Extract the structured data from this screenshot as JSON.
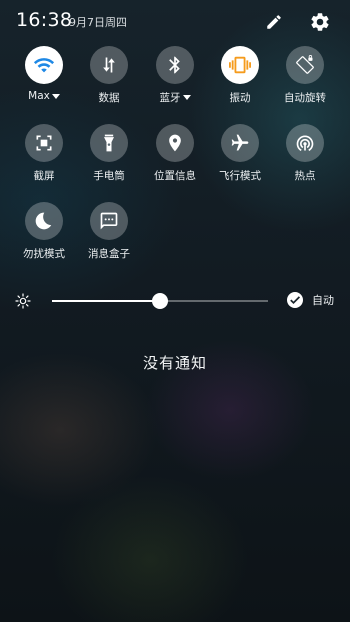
{
  "status_bar": {
    "time": "16:38",
    "date": "9月7日周四",
    "edit_icon": "pencil-icon",
    "settings_icon": "gear-icon"
  },
  "tiles": [
    {
      "label": "Max",
      "icon": "wifi-icon",
      "active": true,
      "dropdown": true
    },
    {
      "label": "数据",
      "icon": "mobile-data-icon",
      "active": false
    },
    {
      "label": "蓝牙",
      "icon": "bluetooth-icon",
      "active": false,
      "dropdown": true
    },
    {
      "label": "振动",
      "icon": "vibrate-icon",
      "active": true
    },
    {
      "label": "自动旋转",
      "icon": "auto-rotate-icon",
      "active": false
    },
    {
      "label": "截屏",
      "icon": "screenshot-icon",
      "active": false
    },
    {
      "label": "手电筒",
      "icon": "flashlight-icon",
      "active": false
    },
    {
      "label": "位置信息",
      "icon": "location-icon",
      "active": false
    },
    {
      "label": "飞行模式",
      "icon": "airplane-icon",
      "active": false
    },
    {
      "label": "热点",
      "icon": "hotspot-icon",
      "active": false
    },
    {
      "label": "勿扰模式",
      "icon": "moon-icon",
      "active": false
    },
    {
      "label": "消息盒子",
      "icon": "message-box-icon",
      "active": false
    }
  ],
  "brightness": {
    "level": 0.5,
    "auto_label": "自动",
    "auto_enabled": true
  },
  "notifications": {
    "empty_text": "没有通知"
  },
  "colors": {
    "wifi_accent": "#1e88e5",
    "vibrate_accent": "#f59b1d"
  }
}
